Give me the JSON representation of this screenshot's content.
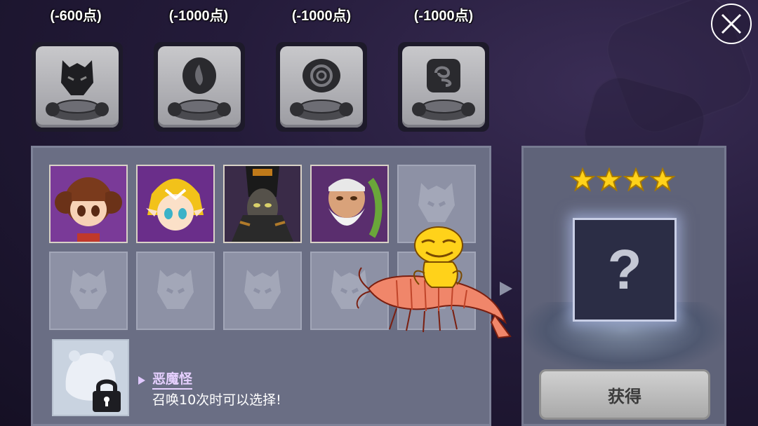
{
  "top_costs": [
    {
      "label": "(-600点)"
    },
    {
      "label": "(-1000点)"
    },
    {
      "label": "(-1000点)"
    },
    {
      "label": "(-1000点)"
    }
  ],
  "categories": [
    {
      "icon": "demon-mask-icon"
    },
    {
      "icon": "fire-rune-icon"
    },
    {
      "icon": "swirl-rune-icon"
    },
    {
      "icon": "wind-rune-icon"
    }
  ],
  "monster_slots": {
    "filled": [
      {
        "icon": "fairy-girl-portrait"
      },
      {
        "icon": "blonde-elf-portrait"
      },
      {
        "icon": "dark-knight-portrait"
      },
      {
        "icon": "old-sage-portrait"
      }
    ],
    "empty_icon": "monster-silhouette-icon",
    "empty_count": 6
  },
  "locked_monster": {
    "name": "恶魔怪",
    "unlock_text": "召唤10次时可以选择!"
  },
  "reward": {
    "stars": 4,
    "mystery_symbol": "?",
    "obtain_label": "获得"
  },
  "colors": {
    "star": "#ffd21a",
    "name_accent": "#e6d0ff",
    "panel": "#6a6e84"
  },
  "overlay_sticker": "shrimp-rider-sticker"
}
